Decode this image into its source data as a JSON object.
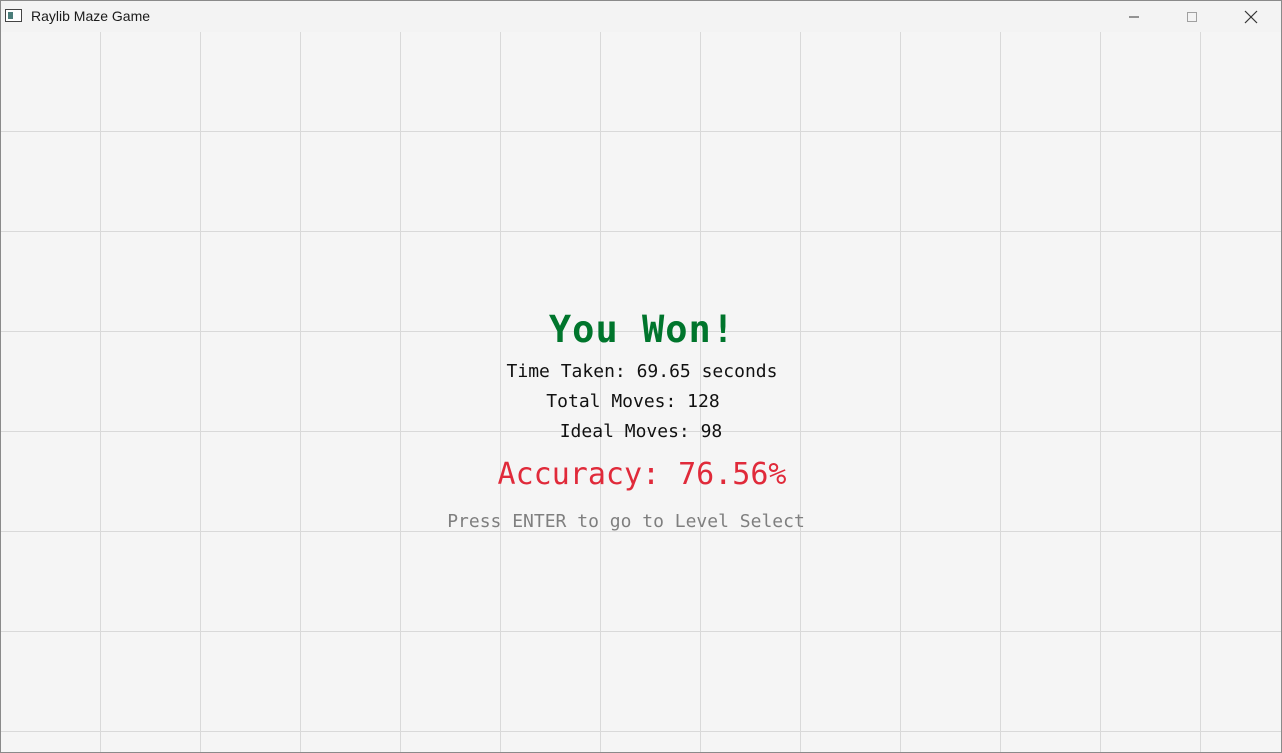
{
  "window": {
    "title": "Raylib Maze Game"
  },
  "controls": {
    "minimize_icon": "minimize-icon",
    "maximize_icon": "maximize-icon",
    "close_icon": "close-icon"
  },
  "result": {
    "heading": "You Won!",
    "time_taken": "Time Taken: 69.65 seconds",
    "total_moves": "Total Moves: 128",
    "ideal_moves": "Ideal Moves: 98",
    "accuracy": "Accuracy: 76.56%",
    "prompt": "Press ENTER to go to Level Select"
  },
  "colors": {
    "heading": "#00752c",
    "accuracy": "#e02a3a",
    "prompt": "#7f7f7f",
    "background": "#f5f5f5",
    "grid": "#d9d9d9"
  }
}
